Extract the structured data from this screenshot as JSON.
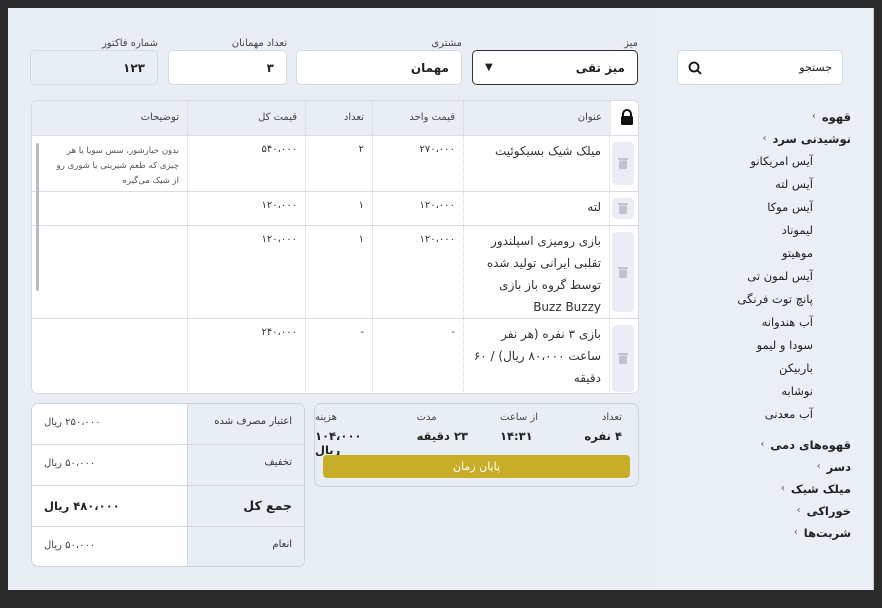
{
  "header": {
    "table_label": "میز",
    "table_value": "میز تقی",
    "customer_label": "مشتری",
    "customer_value": "مهمان",
    "guests_label": "تعداد مهمانان",
    "guests_value": "۳",
    "invoice_label": "شماره فاکتور",
    "invoice_value": "۱۲۳"
  },
  "columns": [
    "عنوان",
    "قیمت واحد",
    "تعداد",
    "قیمت کل",
    "توضیحات"
  ],
  "rows": [
    {
      "title": "میلک شیک بسیکوئیت",
      "unit": "۲۷۰،۰۰۰",
      "qty": "۲",
      "total": "۵۴۰،۰۰۰",
      "note": "بدون خیارشور، سس سویا یا هر چیزی که طعم شیرینی یا شوری رو از شیک می‌گیره"
    },
    {
      "title": "لته",
      "unit": "۱۲۰،۰۰۰",
      "qty": "۱",
      "total": "۱۲۰،۰۰۰",
      "note": ""
    },
    {
      "title": "بازی رومیزی اسپلندور تقلبی ایرانی تولید شده توسط گروه باز بازی Buzz Buzzy",
      "unit": "۱۲۰،۰۰۰",
      "qty": "۱",
      "total": "۱۲۰،۰۰۰",
      "note": ""
    },
    {
      "title": "بازی ۳ نفره (هر نفر ساعت ۸۰،۰۰۰ ریال) / ۶۰ دقیقه",
      "unit": "-",
      "qty": "-",
      "total": "۲۴۰،۰۰۰",
      "note": ""
    }
  ],
  "timer": {
    "count_label": "تعداد",
    "count_value": "۴ نفره",
    "from_label": "از ساعت",
    "from_value": "۱۴:۳۱",
    "duration_label": "مدت",
    "duration_value": "۲۳ دقیقه",
    "cost_label": "هزینه",
    "cost_value": "۱۰۴،۰۰۰ ریال",
    "end_button": "پایان زمان",
    "accent": "#c8ad29"
  },
  "summary": [
    {
      "label": "اعتبار مصرف شده",
      "value": "۲۵۰،۰۰۰ ریال"
    },
    {
      "label": "تخفیف",
      "value": "۵۰،۰۰۰ ریال"
    },
    {
      "label": "جمع کل",
      "value": "۴۸۰،۰۰۰ ریال"
    },
    {
      "label": "انعام",
      "value": "۵۰،۰۰۰ ریال"
    }
  ],
  "sidebar": {
    "search_placeholder": "جستجو",
    "categories": [
      "قهوه",
      "نوشیدنی سرد",
      "قهوه‌های دمی",
      "دسر",
      "میلک شیک",
      "خوراکی",
      "شربت‌ها"
    ],
    "cold_drinks": [
      "آیس امریکانو",
      "آیس لته",
      "آیس موکا",
      "لیموناد",
      "موهیتو",
      "آیس لمون تی",
      "پانچ توت فرنگی",
      "آب هندوانه",
      "سودا و لیمو",
      "باربیکن",
      "نوشابه",
      "آب معدنی"
    ]
  }
}
